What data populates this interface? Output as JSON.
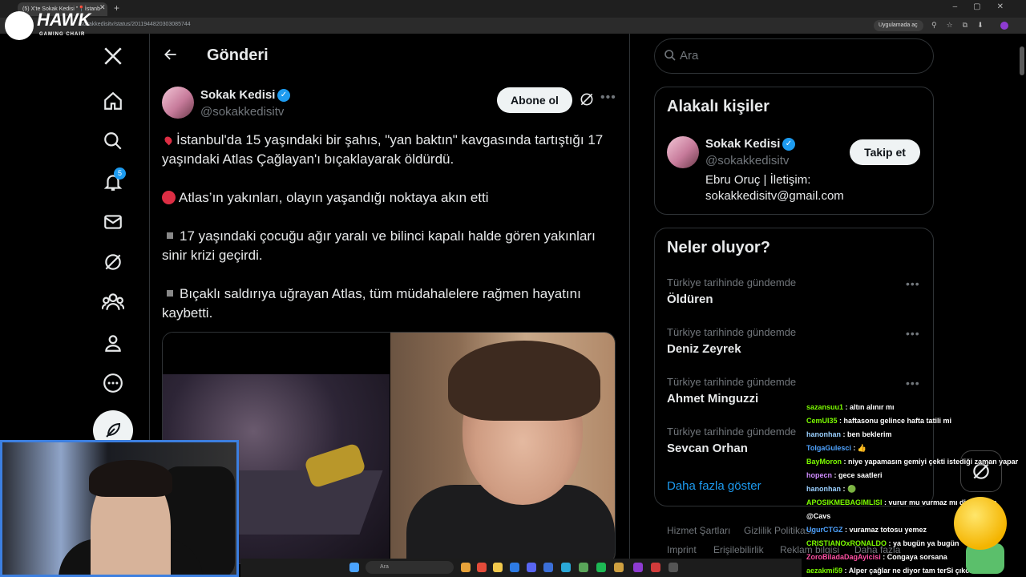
{
  "browser": {
    "tab_title": "(5) X'te Sokak Kedisi \"📍İstanb",
    "url": "sokakkedisitv/status/2011944820303085744",
    "app_pill": "Uygulamada aç"
  },
  "overlay_logo": {
    "brand": "HAWK",
    "sub": "GAMING CHAIR"
  },
  "nav": {
    "notifications_badge": "5"
  },
  "header": {
    "title": "Gönderi"
  },
  "post": {
    "author_name": "Sokak Kedisi",
    "author_handle": "@sokakkedisitv",
    "subscribe_label": "Abone ol",
    "line1": "İstanbul'da 15 yaşındaki bir şahıs, \"yan baktın\" kavgasında tartıştığı 17 yaşındaki Atlas Çağlayan'ı bıçaklayarak öldürdü.",
    "line2": "Atlas’ın yakınları, olayın yaşandığı noktaya akın etti",
    "line3": "17 yaşındaki çocuğu ağır yaralı ve bilinci kapalı halde gören yakınları sinir krizi geçirdi.",
    "line4": "Bıçaklı saldırıya uğrayan Atlas, tüm müdahalelere rağmen hayatını kaybetti."
  },
  "search": {
    "placeholder": "Ara"
  },
  "related": {
    "title": "Alakalı kişiler",
    "name": "Sokak Kedisi",
    "handle": "@sokakkedisitv",
    "follow_label": "Takip et",
    "bio1": "Ebru Oruç | İletişim:",
    "bio2": "sokakkedisitv@gmail.com"
  },
  "trends": {
    "title": "Neler oluyor?",
    "items": [
      {
        "context": "Türkiye tarihinde gündemde",
        "name": "Öldüren"
      },
      {
        "context": "Türkiye tarihinde gündemde",
        "name": "Deniz Zeyrek"
      },
      {
        "context": "Türkiye tarihinde gündemde",
        "name": "Ahmet Minguzzi"
      },
      {
        "context": "Türkiye tarihinde gündemde",
        "name": "Sevcan Orhan"
      }
    ],
    "show_more": "Daha fazla göster"
  },
  "footer": {
    "terms": "Hizmet Şartları",
    "privacy": "Gizlilik Politikası",
    "imprint": "Imprint",
    "accessibility": "Erişilebilirlik",
    "ads": "Reklam bilgisi",
    "more": "Daha fazla"
  },
  "chat": [
    {
      "user": "sazansuu1",
      "msg": "altın alınır mı",
      "color": "#7CFC00"
    },
    {
      "user": "CemUl35",
      "msg": "haftasonu gelince hafta tatili mi",
      "color": "#7CFC00"
    },
    {
      "user": "hanonhan",
      "msg": "ben beklerim",
      "color": "#9ad0ff"
    },
    {
      "user": "TolgaGulesci",
      "msg": "👍",
      "color": "#4fa3ff"
    },
    {
      "user": "BayMoron",
      "msg": "niye yapamasın gemiyi çekti istediği zaman yapar",
      "color": "#7CFC00"
    },
    {
      "user": "hopecn",
      "msg": "gece saatleri",
      "color": "#d08cff"
    },
    {
      "user": "hanonhan",
      "msg": "🟢",
      "color": "#9ad0ff"
    },
    {
      "user": "APOSIKMEBAGIMLISI",
      "msg": "vurur mu vurmaz mı diye bet aç",
      "color": "#7CFC00"
    },
    {
      "user": "",
      "msg": "@Cavs",
      "color": "#ffffff"
    },
    {
      "user": "UgurCTGZ",
      "msg": "vuramaz totosu yemez",
      "color": "#4fa3ff"
    },
    {
      "user": "CRISTIANOxRONALDO",
      "msg": "ya bugün ya bugün",
      "color": "#7CFC00"
    },
    {
      "user": "ZoroBiladaDagAyicisi",
      "msg": "Congaya sorsana",
      "color": "#ff4fa3"
    },
    {
      "user": "aezakmi59",
      "msg": "Alper çağlar ne diyor tam terSi çıkcak",
      "color": "#7CFC00"
    }
  ],
  "taskbar": {
    "search": "Ara"
  },
  "colors": {
    "accent": "#1d9bf0",
    "background": "#000000",
    "border": "#2f3336"
  }
}
